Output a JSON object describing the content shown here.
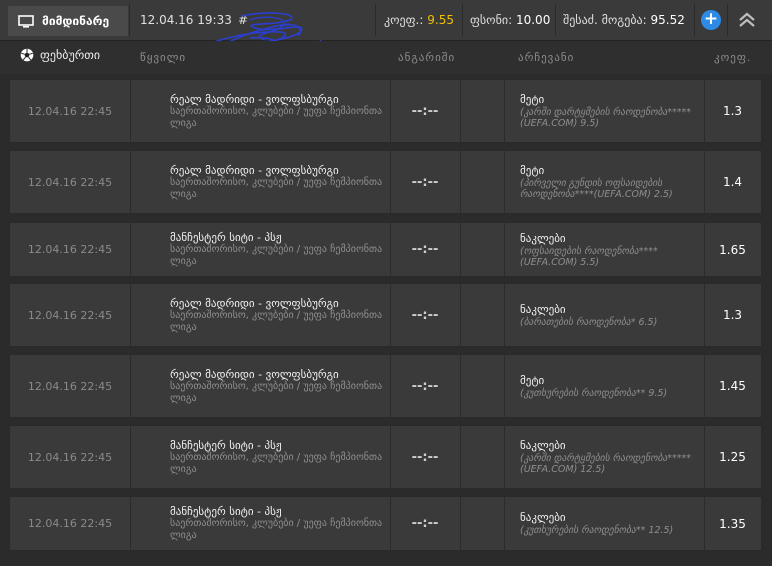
{
  "topbar": {
    "tab_label": "მიმდინარე",
    "datetime": "12.04.16 19:33",
    "hash_prefix": "#",
    "coef_label": "კოეფ.:",
    "coef_value": "9.55",
    "stake_label": "ფსონი:",
    "stake_value": "10.00",
    "win_label": "შესაძ. მოგება:",
    "win_value": "95.52",
    "add_label": "+",
    "coef_color": "#f0c200",
    "add_button_color": "#2d8be6"
  },
  "header": {
    "sport": "ფეხბურთი",
    "event": "წყვილი",
    "score": "ანგარიში",
    "choice": "არჩევანი",
    "coef": "კოეფ."
  },
  "rows": [
    {
      "date": "12.04.16 22:45",
      "event": "რეალ მადრიდი - ვოლფსბურგი",
      "league": "საერთაშორისო, კლუბები / უეფა ჩემპიონთა ლიგა",
      "score": "--:--",
      "choice": "მეტი",
      "choice_detail": "(კარში დარტყმების რაოდენობა*****(UEFA.COM) 9.5)",
      "coef": "1.3"
    },
    {
      "date": "12.04.16 22:45",
      "event": "რეალ მადრიდი - ვოლფსბურგი",
      "league": "საერთაშორისო, კლუბები / უეფა ჩემპიონთა ლიგა",
      "score": "--:--",
      "choice": "მეტი",
      "choice_detail": "(პირველი გუნდის ოფსაიდების რაოდენობა****(UEFA.COM) 2.5)",
      "coef": "1.4"
    },
    {
      "date": "12.04.16 22:45",
      "event": "მანჩესტერ სიტი - პსჟ",
      "league": "საერთაშორისო, კლუბები / უეფა ჩემპიონთა ლიგა",
      "score": "--:--",
      "choice": "ნაკლები",
      "choice_detail": "(ოფსაიდების რაოდენობა****(UEFA.COM) 5.5)",
      "coef": "1.65"
    },
    {
      "date": "12.04.16 22:45",
      "event": "რეალ მადრიდი - ვოლფსბურგი",
      "league": "საერთაშორისო, კლუბები / უეფა ჩემპიონთა ლიგა",
      "score": "--:--",
      "choice": "ნაკლები",
      "choice_detail": "(ბარათების რაოდენობა* 6.5)",
      "coef": "1.3"
    },
    {
      "date": "12.04.16 22:45",
      "event": "რეალ მადრიდი - ვოლფსბურგი",
      "league": "საერთაშორისო, კლუბები / უეფა ჩემპიონთა ლიგა",
      "score": "--:--",
      "choice": "მეტი",
      "choice_detail": "(კუთხურების რაოდენობა** 9.5)",
      "coef": "1.45"
    },
    {
      "date": "12.04.16 22:45",
      "event": "მანჩესტერ სიტი - პსჟ",
      "league": "საერთაშორისო, კლუბები / უეფა ჩემპიონთა ლიგა",
      "score": "--:--",
      "choice": "ნაკლები",
      "choice_detail": "(კარში დარტყმების რაოდენობა*****(UEFA.COM) 12.5)",
      "coef": "1.25"
    },
    {
      "date": "12.04.16 22:45",
      "event": "მანჩესტერ სიტი - პსჟ",
      "league": "საერთაშორისო, კლუბები / უეფა ჩემპიონთა ლიგა",
      "score": "--:--",
      "choice": "ნაკლები",
      "choice_detail": "(კუთხურების რაოდენობა** 12.5)",
      "coef": "1.35"
    }
  ]
}
